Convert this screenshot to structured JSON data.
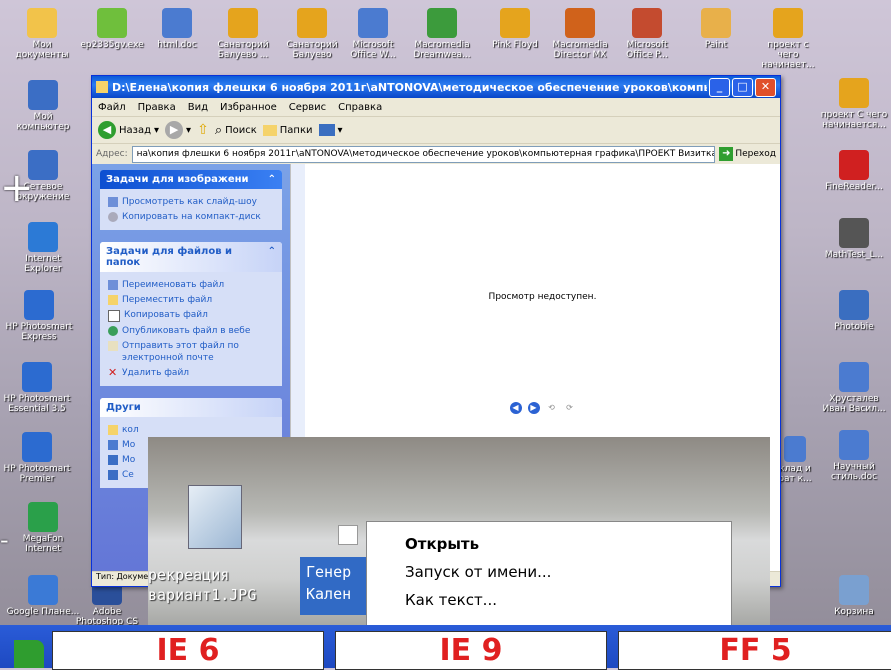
{
  "desktop_top_icons": [
    {
      "label": "Мои документы",
      "color": "#f2c34a"
    },
    {
      "label": "ep2335gv.exe",
      "color": "#6fbf3c"
    },
    {
      "label": "html.doc",
      "color": "#4b7bd0"
    },
    {
      "label": "Санаторий Балуево ...",
      "color": "#e5a41d"
    },
    {
      "label": "Санаторий Балуево",
      "color": "#e5a41d"
    },
    {
      "label": "Microsoft Office W...",
      "color": "#4b7bd0"
    },
    {
      "label": "Macromedia Dreamwea...",
      "color": "#3c9b3c"
    },
    {
      "label": "Pink Floyd",
      "color": "#e5a41d"
    },
    {
      "label": "Macromedia Director MX",
      "color": "#d0621b"
    },
    {
      "label": "Microsoft Office P...",
      "color": "#c44b2f"
    },
    {
      "label": "Paint",
      "color": "#e8b04a"
    },
    {
      "label": "проект с чего начинает...",
      "color": "#e5a41d"
    }
  ],
  "desktop_left_icons": [
    {
      "label": "Мой компьютер",
      "color": "#3b6ec5"
    },
    {
      "label": "Сетевое окружение",
      "color": "#3b6ec5"
    },
    {
      "label": "Internet Explorer",
      "color": "#2c7ad6"
    },
    {
      "label": "HP Photosmart Express",
      "color": "#2c6bd0"
    },
    {
      "label": "HP Photosmart Essential 3.5",
      "color": "#2c6bd0"
    },
    {
      "label": "HP Photosmart Premier",
      "color": "#2c6bd0"
    },
    {
      "label": "MegaFon Internet",
      "color": "#2aa04a"
    },
    {
      "label": "Google Плане...",
      "color": "#3b7ad6"
    },
    {
      "label": "Adobe Photoshop CS",
      "color": "#2a4f9a"
    }
  ],
  "desktop_right_icons": [
    {
      "label": "проект С чего начинается...",
      "color": "#e5a41d"
    },
    {
      "label": "FineReader...",
      "color": "#d02020"
    },
    {
      "label": "MathTest_L...",
      "color": "#555555"
    },
    {
      "label": "Photobie",
      "color": "#3a6ec0"
    },
    {
      "label": "Хрусталев Иван Васил...",
      "color": "#4b7bd0"
    },
    {
      "label": "Научный стиль.doc",
      "color": "#4b7bd0"
    },
    {
      "label": "Корзина",
      "color": "#7aa0d0"
    }
  ],
  "desktop_partial_labels": [
    "клад и рат к..."
  ],
  "window": {
    "title": "D:\\Елена\\копия флешки 6 ноября 2011г\\aNTONOVA\\методическое обеспечение уроков\\компьютерная граф",
    "menu": [
      "Файл",
      "Правка",
      "Вид",
      "Избранное",
      "Сервис",
      "Справка"
    ],
    "toolbar": {
      "back": "Назад",
      "search": "Поиск",
      "folders": "Папки"
    },
    "address_label": "Адрес:",
    "address_value": "на\\копия флешки 6 ноября 2011г\\aNTONOVA\\методическое обеспечение уроков\\компьютерная графика\\ПРОЕКТ Визитка",
    "go_label": "Переход",
    "panel_image_tasks": {
      "title": "Задачи для изображени",
      "links": [
        "Просмотреть как слайд-шоу",
        "Копировать на компакт-диск"
      ]
    },
    "panel_file_tasks": {
      "title": "Задачи для файлов и папок",
      "links": [
        "Переименовать файл",
        "Переместить файл",
        "Копировать файл",
        "Опубликовать файл в вебе",
        "Отправить этот файл по электронной почте",
        "Удалить файл"
      ]
    },
    "panel_other": {
      "title": "Други",
      "links": [
        "кол",
        "Мо",
        "Мо",
        "Се"
      ]
    },
    "preview_message": "Просмотр недоступен.",
    "status": "Тип: Докуме"
  },
  "overlay": {
    "file_name": "рекреация\nвариант1.JPG",
    "selected_name": "Генер\nКален",
    "context_menu": [
      "Открыть",
      "Запуск от имени...",
      "Как текст..."
    ]
  },
  "taskbar": {
    "tiles": [
      "IE 6",
      "IE 9",
      "FF 5"
    ]
  }
}
